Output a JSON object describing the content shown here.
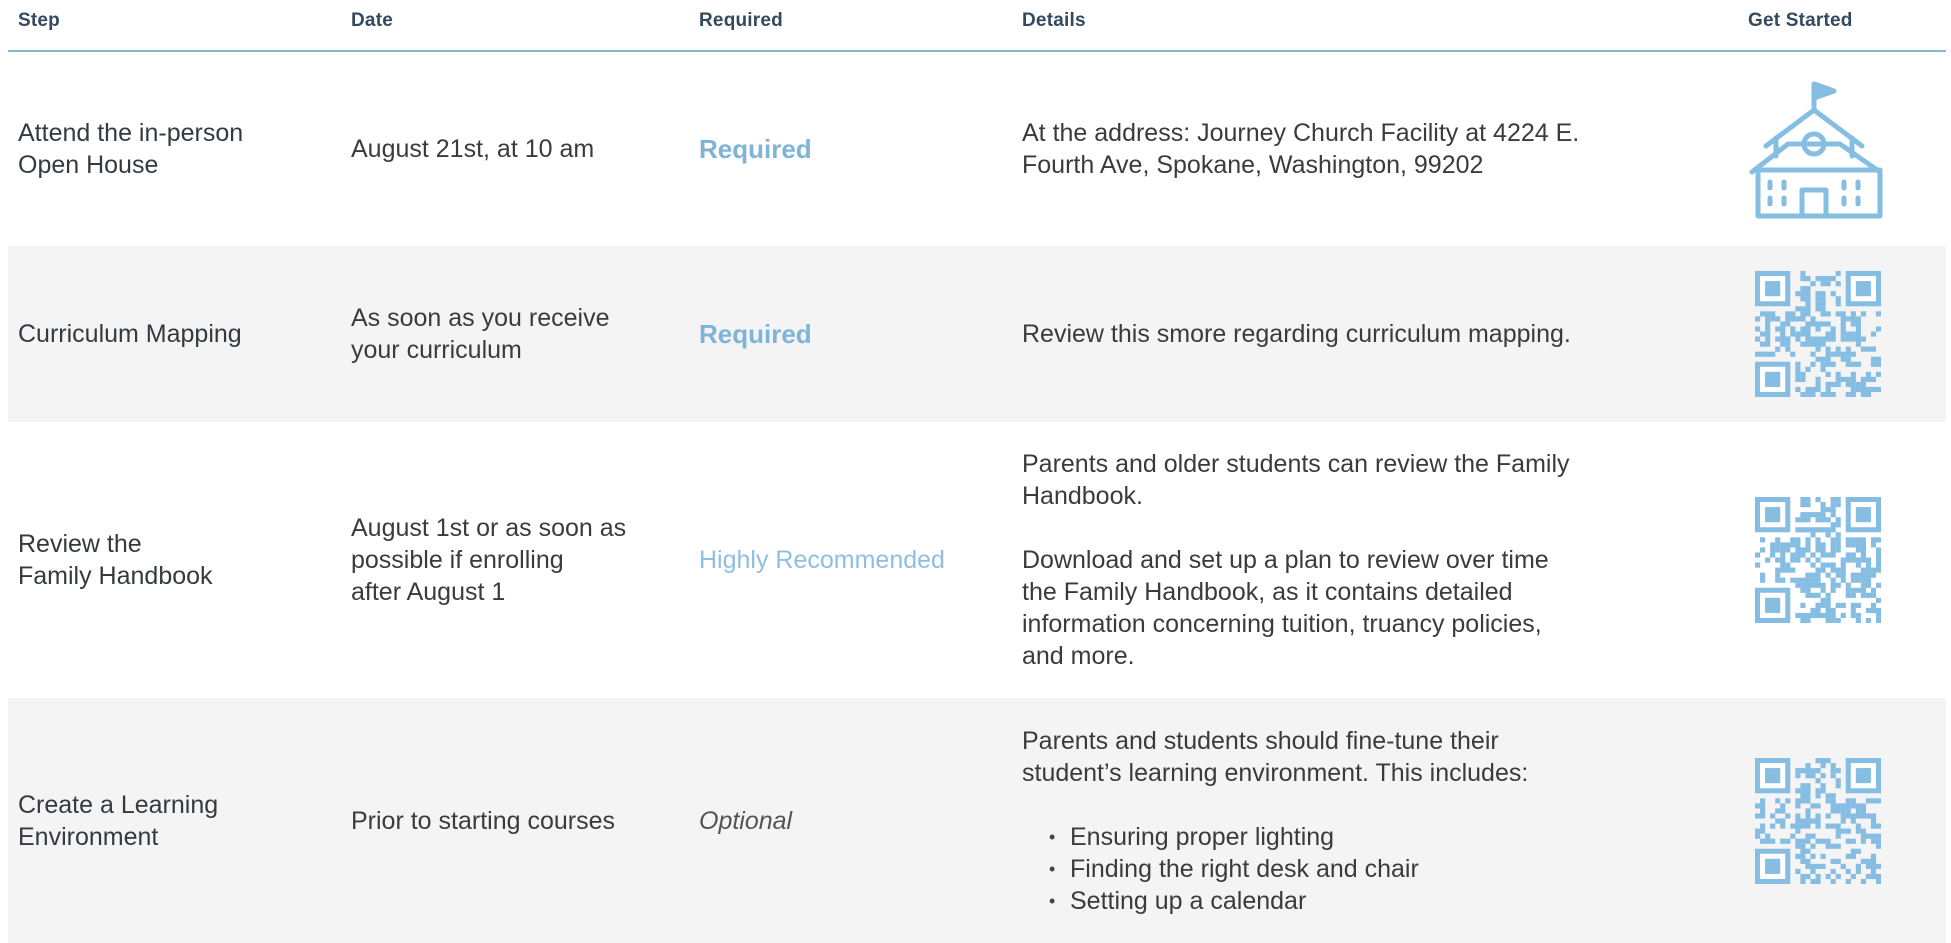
{
  "headers": {
    "step": "Step",
    "date": "Date",
    "required": "Required",
    "details": "Details",
    "get_started": "Get Started"
  },
  "rows": [
    {
      "step": [
        "Attend the in-person",
        "Open House"
      ],
      "date": [
        "August 21st, at 10 am"
      ],
      "required": "Required",
      "details": [
        "At the address: Journey Church Facility at 4224 E.",
        "Fourth Ave, Spokane, Washington, 99202"
      ],
      "icon": "school-icon"
    },
    {
      "step": [
        "Curriculum Mapping"
      ],
      "date": [
        "As soon as you receive",
        "your curriculum"
      ],
      "required": "Required",
      "details": [
        "Review this smore regarding curriculum mapping."
      ],
      "icon": "qr-code-icon"
    },
    {
      "step": [
        "Review the",
        "Family Handbook"
      ],
      "date": [
        "August 1st or as soon as",
        "possible if enrolling",
        "after August 1"
      ],
      "required": "Highly Recommended",
      "details_p1": [
        "Parents and older students can review the Family",
        "Handbook."
      ],
      "details_p2": [
        "Download and set up a plan to review over time",
        "the Family Handbook, as it contains detailed",
        "information concerning tuition, truancy policies,",
        "and more."
      ],
      "icon": "qr-code-icon"
    },
    {
      "step": [
        "Create a Learning",
        "Environment"
      ],
      "date": [
        "Prior to starting courses"
      ],
      "required": "Optional",
      "details_intro": [
        "Parents and students should fine-tune their",
        "student’s learning environment. This includes:"
      ],
      "details_bullets": [
        "Ensuring proper lighting",
        "Finding the right desk and chair",
        "Setting up a calendar"
      ],
      "icon": "qr-code-icon"
    }
  ],
  "colors": {
    "accent": "#7fb4d9",
    "header_text": "#34495e",
    "header_rule": "#88b6cf",
    "alt_row": "#f4f4f4"
  }
}
